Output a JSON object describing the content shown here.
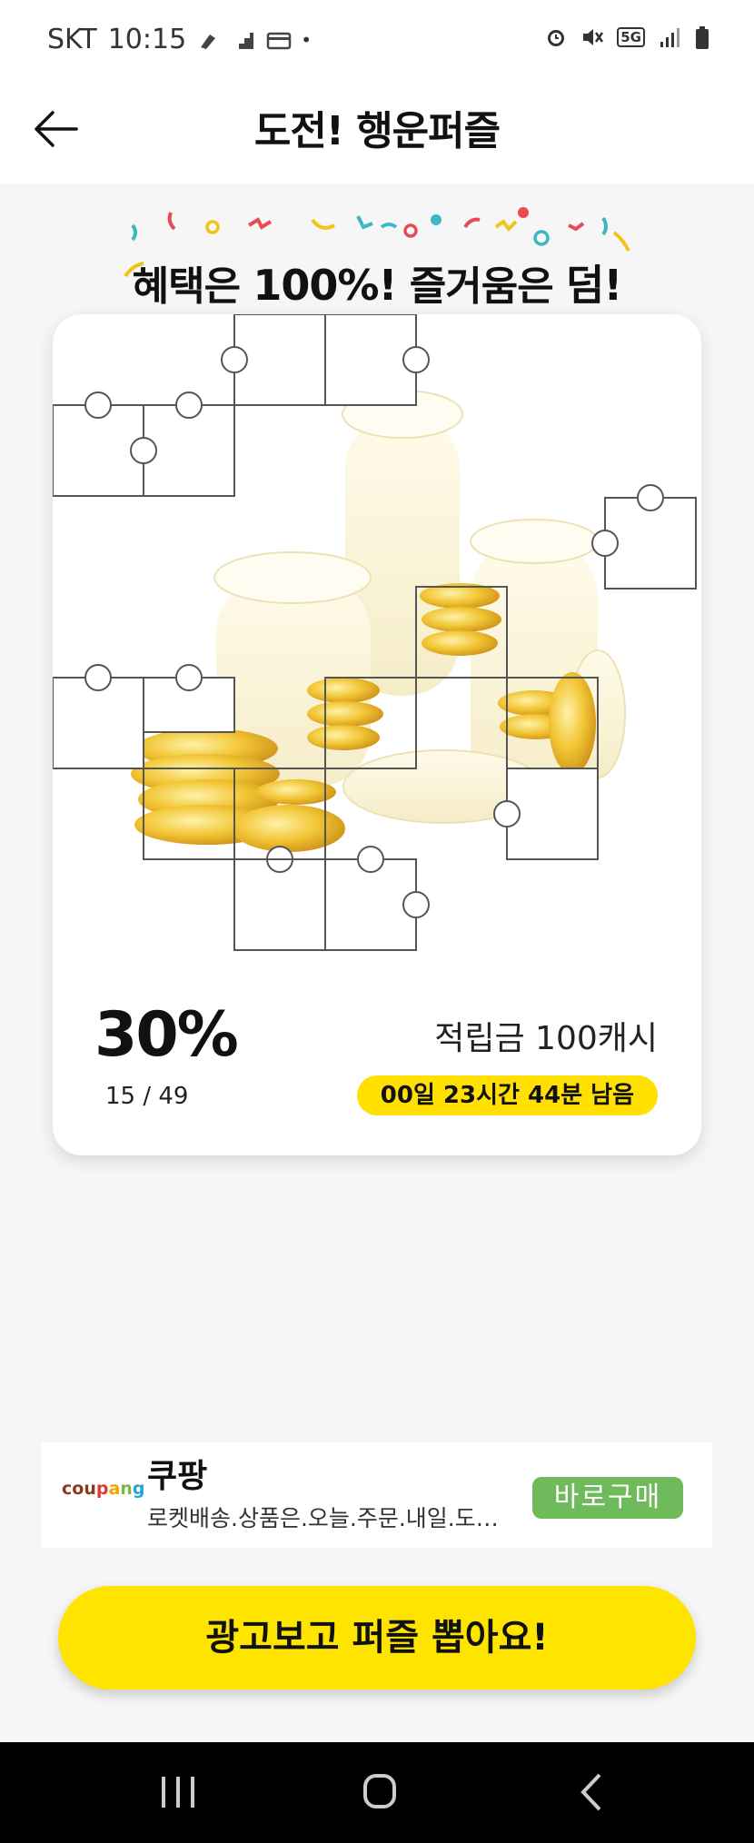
{
  "status_bar": {
    "carrier": "SKT",
    "time": "10:15",
    "network": "5G"
  },
  "header": {
    "title": "도전! 행운퍼즐"
  },
  "banner": {
    "text_a": "혜택은 ",
    "text_b": "100%!",
    "text_c": " 즐거움은 ",
    "text_d": "덤!"
  },
  "puzzle_card": {
    "progress_percent": "30%",
    "pieces_count": "15 / 49",
    "reward": "적립금 100캐시",
    "time_left": "00일 23시간 44분 남음"
  },
  "ad": {
    "logo": "coupang",
    "title": "쿠팡",
    "description": "로켓배송.상품은.오늘.주문.내일.도…",
    "button": "바로구매"
  },
  "cta": {
    "label": "광고보고 퍼즐 뽑아요!"
  },
  "colors": {
    "accent": "#ffe400",
    "ad_button": "#6fba5a"
  },
  "nav_icons": [
    "recents-icon",
    "home-icon",
    "back-icon"
  ]
}
